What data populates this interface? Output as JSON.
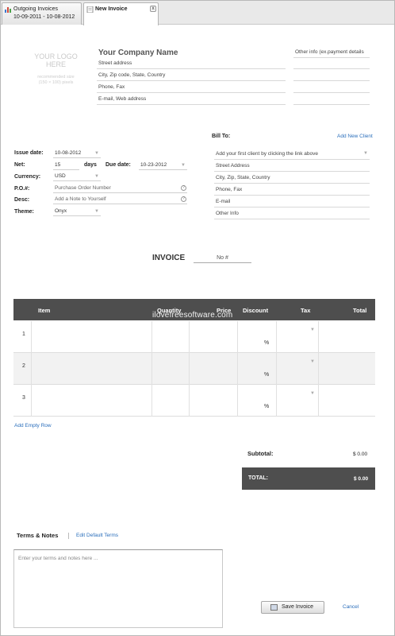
{
  "tabs": [
    {
      "line1": "Outgoing Invoices",
      "line2": "10-09-2011 - 10-08-2012"
    },
    {
      "line1": "New Invoice",
      "close": "x"
    }
  ],
  "logo": {
    "line1": "YOUR LOGO",
    "line2": "HERE",
    "hint1": "recommended size",
    "hint2": "(150 × 100) pixels"
  },
  "company": {
    "name": "Your Company Name",
    "lines": [
      "Street address",
      "City, Zip code, State, Country",
      "Phone, Fax",
      "E-mail, Web address"
    ],
    "other_info": "Other info (ex.payment details"
  },
  "fields": {
    "issue_date": {
      "label": "Issue date:",
      "value": "10-08-2012"
    },
    "net": {
      "label": "Net:",
      "value": "15",
      "unit": "days"
    },
    "due_date": {
      "label": "Due date:",
      "value": "10-23-2012"
    },
    "currency": {
      "label": "Currency:",
      "value": "USD"
    },
    "po": {
      "label": "P.O.#:",
      "value": "Purchase Order Number"
    },
    "desc": {
      "label": "Desc:",
      "value": "Add a Note to Yourself"
    },
    "theme": {
      "label": "Theme:",
      "value": "Onyx"
    }
  },
  "bill_to": {
    "label": "Bill To:",
    "add_client": "Add New Client",
    "select_placeholder": "Add your first client by clicking the link above",
    "lines": [
      "Street Address",
      "City, Zip, State, Country",
      "Phone, Fax",
      "E-mail",
      "Other Info"
    ]
  },
  "invoice": {
    "title": "INVOICE",
    "number": "No #"
  },
  "table": {
    "headers": [
      "Item",
      "Quantity",
      "Price",
      "Discount",
      "Tax",
      "Total"
    ],
    "watermark": "ilovefreesoftware.com",
    "rows": [
      {
        "num": "1",
        "pct": "%"
      },
      {
        "num": "2",
        "pct": "%"
      },
      {
        "num": "3",
        "pct": "%"
      }
    ],
    "add_row": "Add Empty Row"
  },
  "totals": {
    "subtotal_label": "Subtotal:",
    "subtotal_value": "$ 0.00",
    "total_label": "TOTAL:",
    "total_value": "$ 0.00"
  },
  "terms": {
    "label": "Terms & Notes",
    "edit_link": "Edit Default Terms",
    "placeholder": "Enter your terms and notes here ..."
  },
  "actions": {
    "save": "Save Invoice",
    "cancel": "Cancel"
  },
  "icons": {
    "tab1": "chart-icon",
    "tab2": "document-icon",
    "save": "disk-icon",
    "dropdown": "chevron-down-icon",
    "help": "help-icon"
  }
}
